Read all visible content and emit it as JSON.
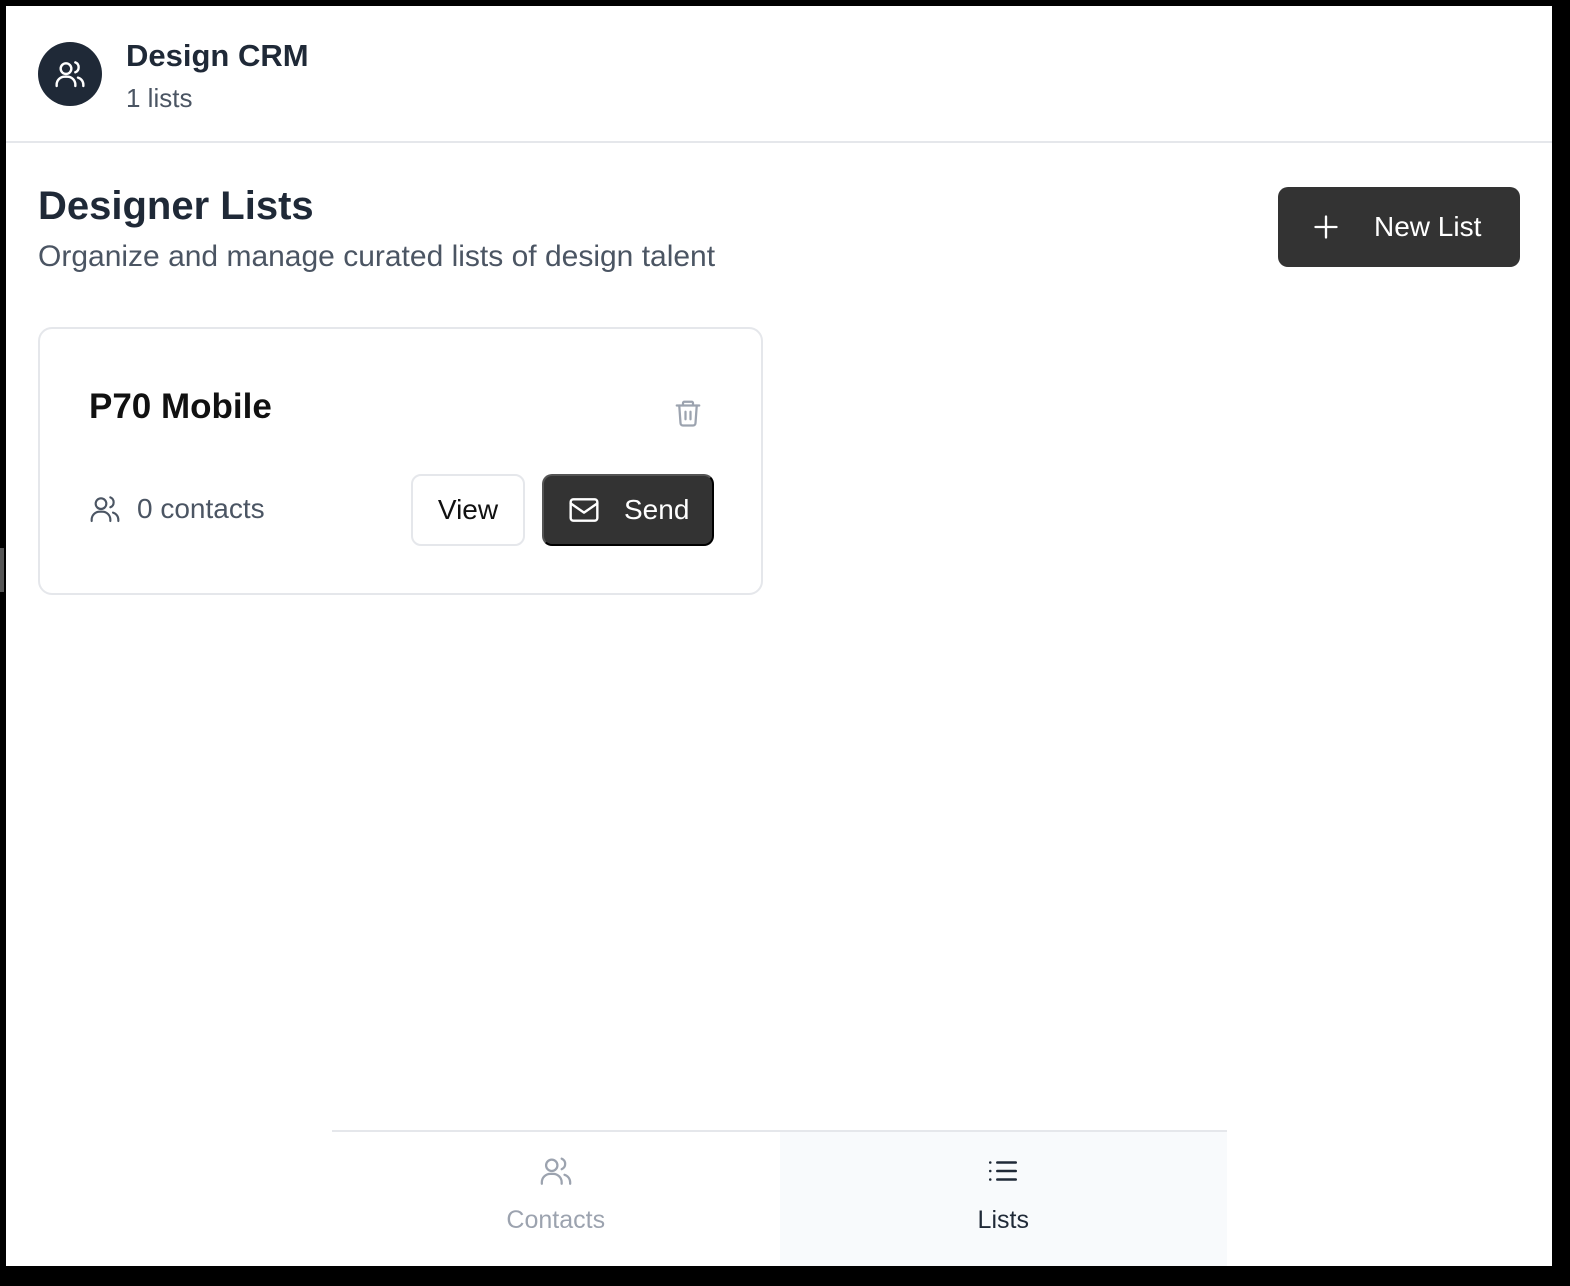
{
  "header": {
    "title": "Design CRM",
    "subtitle": "1 lists",
    "avatar_icon": "users-icon"
  },
  "page": {
    "title": "Designer Lists",
    "subtitle": "Organize and manage curated lists of design talent",
    "new_list_label": "New List",
    "new_list_icon": "plus-icon"
  },
  "lists": [
    {
      "name": "P70 Mobile",
      "contacts_label": "0 contacts",
      "view_label": "View",
      "send_label": "Send",
      "delete_icon": "trash-icon",
      "send_icon": "mail-icon"
    }
  ],
  "nav": {
    "tabs": [
      {
        "label": "Contacts",
        "icon": "users-icon",
        "active": false
      },
      {
        "label": "Lists",
        "icon": "list-icon",
        "active": true
      }
    ]
  },
  "colors": {
    "primary_dark": "#333333",
    "avatar_bg": "#1f2937",
    "border": "#e5e7eb",
    "muted_text": "#4b5563"
  }
}
